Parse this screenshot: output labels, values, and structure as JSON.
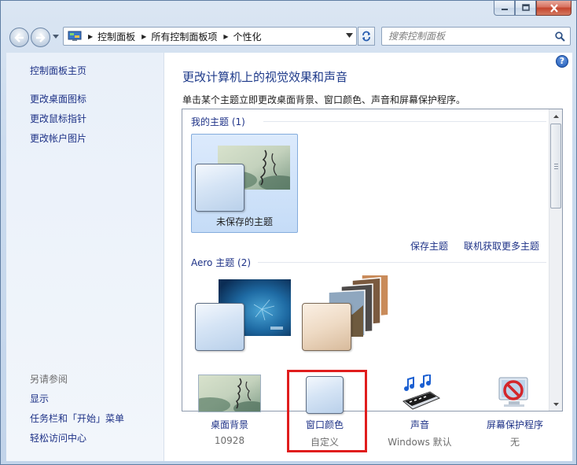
{
  "window": {
    "caption_buttons": [
      "minimize",
      "maximize",
      "close"
    ]
  },
  "navbar": {
    "breadcrumbs": [
      "控制面板",
      "所有控制面板项",
      "个性化"
    ],
    "search_placeholder": "搜索控制面板"
  },
  "sidebar": {
    "home_link": "控制面板主页",
    "links": [
      "更改桌面图标",
      "更改鼠标指针",
      "更改帐户图片"
    ],
    "see_also_heading": "另请参阅",
    "see_also_links": [
      "显示",
      "任务栏和「开始」菜单",
      "轻松访问中心"
    ]
  },
  "main": {
    "title": "更改计算机上的视觉效果和声音",
    "description": "单击某个主题立即更改桌面背景、窗口颜色、声音和屏幕保护程序。",
    "my_themes_header": "我的主题 (1)",
    "unsaved_theme_label": "未保存的主题",
    "save_theme_link": "保存主题",
    "get_more_link": "联机获取更多主题",
    "aero_header": "Aero 主题 (2)"
  },
  "actions": [
    {
      "label": "桌面背景",
      "sub": "10928",
      "icon": "wallpaper-icon"
    },
    {
      "label": "窗口颜色",
      "sub": "自定义",
      "icon": "window-color-icon"
    },
    {
      "label": "声音",
      "sub": "Windows 默认",
      "icon": "sound-icon"
    },
    {
      "label": "屏幕保护程序",
      "sub": "无",
      "icon": "screensaver-icon"
    }
  ],
  "colors": {
    "link": "#1e3287",
    "title": "#1e3a8a",
    "highlight": "#e01d1d",
    "selection": "#c5dcf7"
  }
}
